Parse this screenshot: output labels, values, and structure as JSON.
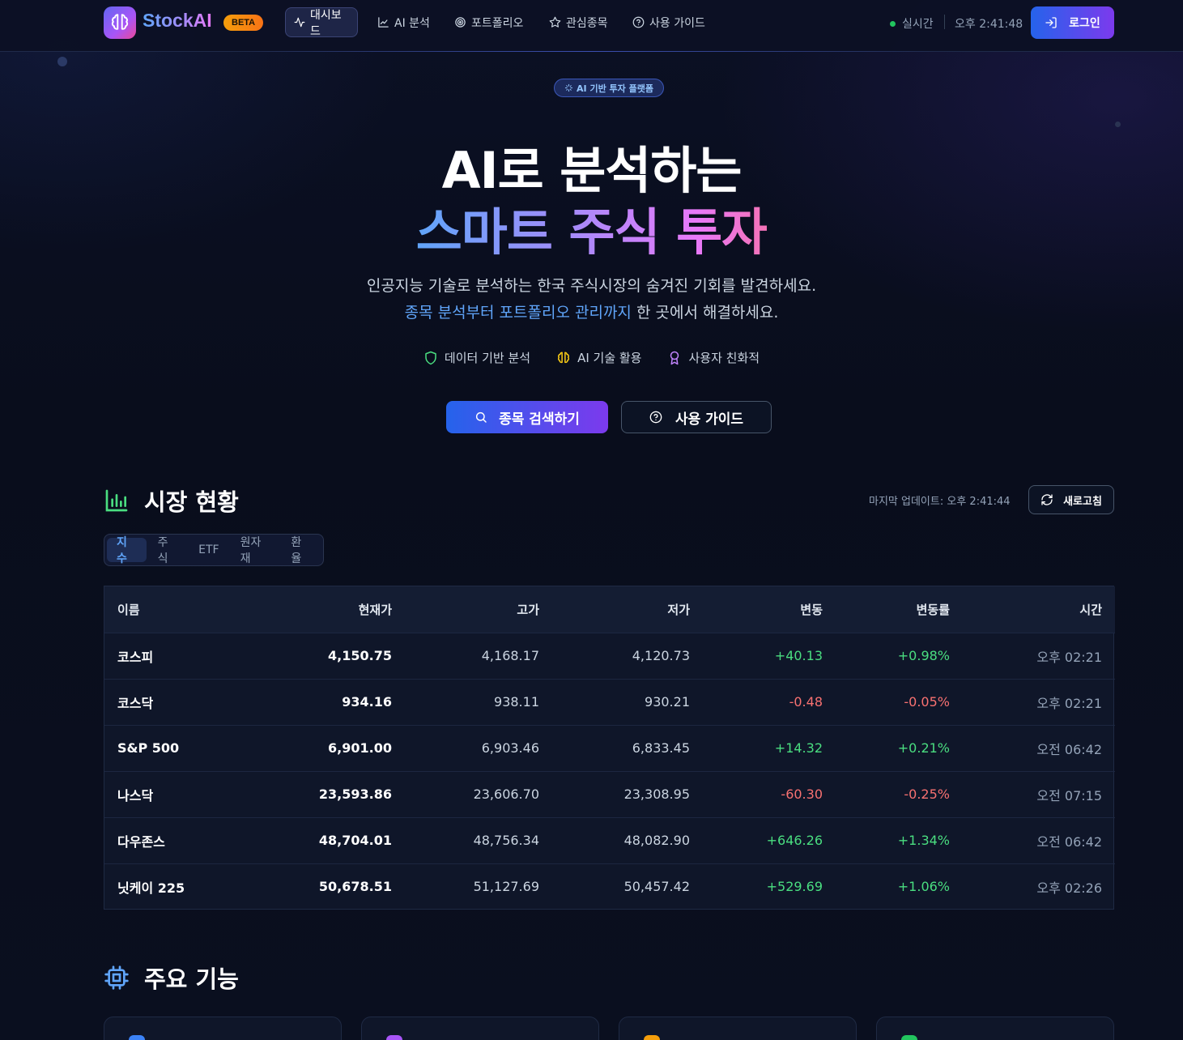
{
  "header": {
    "logo_text": "StockAI",
    "beta_label": "BETA",
    "nav": [
      {
        "label": "대시보드",
        "icon": "activity-icon"
      },
      {
        "label": "AI 분석",
        "icon": "line-chart-icon"
      },
      {
        "label": "포트폴리오",
        "icon": "target-icon"
      },
      {
        "label": "관심종목",
        "icon": "star-icon"
      },
      {
        "label": "사용 가이드",
        "icon": "help-circle-icon"
      }
    ],
    "status_label": "실시간",
    "clock": "오후 2:41:48",
    "login_label": "로그인"
  },
  "hero": {
    "badge": "AI 기반 투자 플랫폼",
    "title_line1": "AI로 분석하는",
    "title_line2": "스마트 주식 투자",
    "subtitle_line1": "인공지능 기술로 분석하는 한국 주식시장의 숨겨진 기회를 발견하세요.",
    "subtitle_line2_highlight": "종목 분석부터 포트폴리오 관리까지",
    "subtitle_line2_rest": " 한 곳에서 해결하세요.",
    "features": [
      {
        "label": "데이터 기반 분석",
        "icon": "shield-icon",
        "color": "#4ade80"
      },
      {
        "label": "AI 기술 활용",
        "icon": "brain-icon",
        "color": "#facc15"
      },
      {
        "label": "사용자 친화적",
        "icon": "award-icon",
        "color": "#c084fc"
      }
    ],
    "primary_button": "종목 검색하기",
    "secondary_button": "사용 가이드"
  },
  "market": {
    "title": "시장 현황",
    "last_update": "마지막 업데이트: 오후 2:41:44",
    "refresh_label": "새로고침",
    "tabs": [
      "지수",
      "주식",
      "ETF",
      "원자재",
      "환율"
    ],
    "active_tab": "지수",
    "columns": [
      "이름",
      "현재가",
      "고가",
      "저가",
      "변동",
      "변동률",
      "시간"
    ],
    "rows": [
      {
        "name": "코스피",
        "current": "4,150.75",
        "high": "4,168.17",
        "low": "4,120.73",
        "change": "+40.13",
        "rate": "+0.98%",
        "time": "오후 02:21",
        "dir": "up"
      },
      {
        "name": "코스닥",
        "current": "934.16",
        "high": "938.11",
        "low": "930.21",
        "change": "-0.48",
        "rate": "-0.05%",
        "time": "오후 02:21",
        "dir": "down"
      },
      {
        "name": "S&P 500",
        "current": "6,901.00",
        "high": "6,903.46",
        "low": "6,833.45",
        "change": "+14.32",
        "rate": "+0.21%",
        "time": "오전 06:42",
        "dir": "up"
      },
      {
        "name": "나스닥",
        "current": "23,593.86",
        "high": "23,606.70",
        "low": "23,308.95",
        "change": "-60.30",
        "rate": "-0.25%",
        "time": "오전 07:15",
        "dir": "down"
      },
      {
        "name": "다우존스",
        "current": "48,704.01",
        "high": "48,756.34",
        "low": "48,082.90",
        "change": "+646.26",
        "rate": "+1.34%",
        "time": "오전 06:42",
        "dir": "up"
      },
      {
        "name": "닛케이 225",
        "current": "50,678.51",
        "high": "51,127.69",
        "low": "50,457.42",
        "change": "+529.69",
        "rate": "+1.06%",
        "time": "오후 02:26",
        "dir": "up"
      }
    ]
  },
  "features_section": {
    "title": "주요 기능",
    "card_icon_colors": [
      "#3b82f6",
      "#a855f7",
      "#f59e0b",
      "#22c55e"
    ]
  },
  "colors": {
    "accent_blue": "#2563eb",
    "accent_purple": "#7c3aed",
    "up": "#4ade80",
    "down": "#f87171"
  }
}
